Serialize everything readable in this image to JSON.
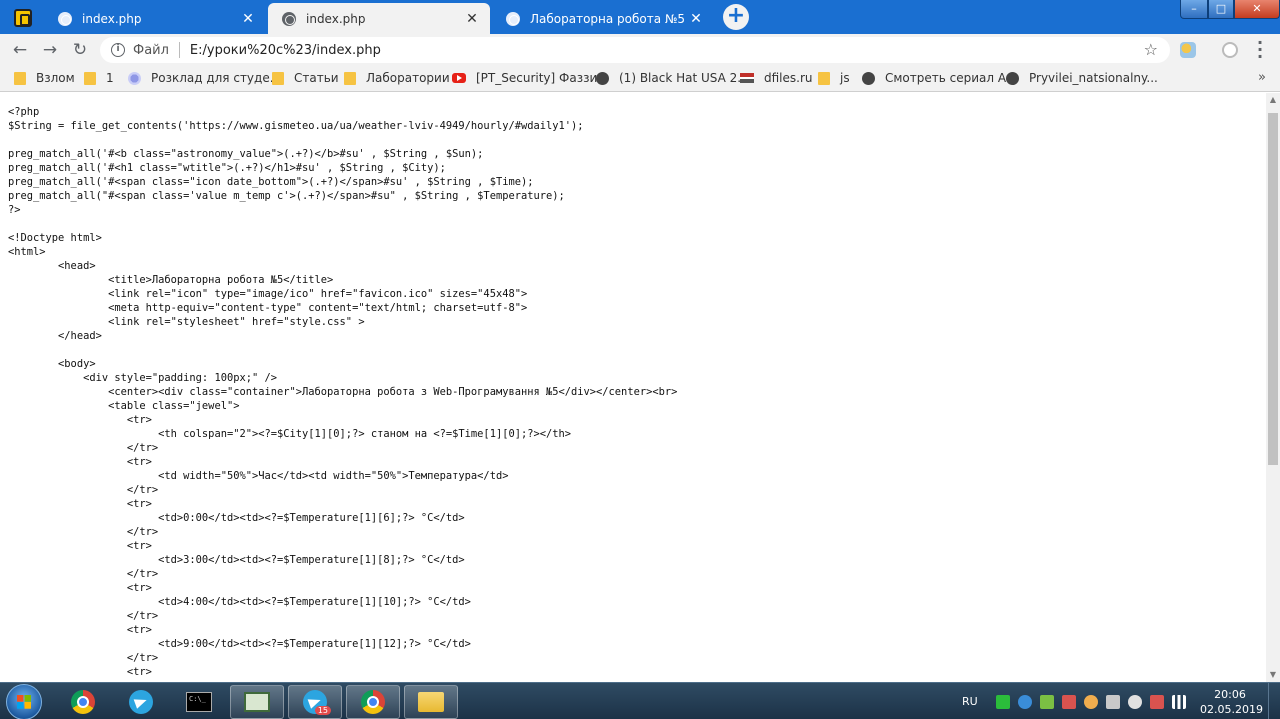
{
  "tabs": [
    {
      "title": "index.php",
      "active": false
    },
    {
      "title": "index.php",
      "active": true
    },
    {
      "title": "Лабораторна робота №5",
      "active": false
    }
  ],
  "window_controls": {
    "minimize": "–",
    "maximize": "□",
    "close": "✕"
  },
  "address_bar": {
    "scheme_label": "Файл",
    "url": "E:/уроки%20c%23/index.php"
  },
  "bookmarks": [
    {
      "label": "Взлом",
      "icon": "folder-icon"
    },
    {
      "label": "1",
      "icon": "folder-icon"
    },
    {
      "label": "Розклад для студе...",
      "icon": "schedule-icon"
    },
    {
      "label": "Статьи",
      "icon": "folder-icon"
    },
    {
      "label": "Лаборатории",
      "icon": "folder-icon"
    },
    {
      "label": "[PT_Security] Фаззи...",
      "icon": "youtube-icon"
    },
    {
      "label": "(1) Black Hat USA 2...",
      "icon": "github-icon"
    },
    {
      "label": "dfiles.ru",
      "icon": "dfiles-icon"
    },
    {
      "label": "js",
      "icon": "folder-icon"
    },
    {
      "label": "Смотреть сериал А...",
      "icon": "github-icon"
    },
    {
      "label": "Pryvilei_natsionalny...",
      "icon": "github-icon"
    }
  ],
  "bookmarks_more": "»",
  "code_lines": [
    "<?php",
    "$String = file_get_contents('https://www.gismeteo.ua/ua/weather-lviv-4949/hourly/#wdaily1');",
    "",
    "preg_match_all('#<b class=\"astronomy_value\">(.+?)</b>#su' , $String , $Sun);",
    "preg_match_all('#<h1 class=\"wtitle\">(.+?)</h1>#su' , $String , $City);",
    "preg_match_all('#<span class=\"icon date_bottom\">(.+?)</span>#su' , $String , $Time);",
    "preg_match_all(\"#<span class='value m_temp c'>(.+?)</span>#su\" , $String , $Temperature);",
    "?>",
    "",
    "<!Doctype html>",
    "<html>",
    "        <head>",
    "                <title>Лабораторна робота №5</title>",
    "                <link rel=\"icon\" type=\"image/ico\" href=\"favicon.ico\" sizes=\"45x48\">",
    "                <meta http-equiv=\"content-type\" content=\"text/html; charset=utf-8\">",
    "                <link rel=\"stylesheet\" href=\"style.css\" >",
    "        </head>",
    "",
    "        <body>",
    "            <div style=\"padding: 100px;\" />",
    "                <center><div class=\"container\">Лабораторна робота з Web-Програмування №5</div></center><br>",
    "                <table class=\"jewel\">",
    "                   <tr>",
    "                        <th colspan=\"2\"><?=$City[1][0];?> станом на <?=$Time[1][0];?></th>",
    "                   </tr>",
    "                   <tr>",
    "                        <td width=\"50%\">Час</td><td width=\"50%\">Температура</td>",
    "                   </tr>",
    "                   <tr>",
    "                        <td>0:00</td><td><?=$Temperature[1][6];?> °C</td>",
    "                   </tr>",
    "                   <tr>",
    "                        <td>3:00</td><td><?=$Temperature[1][8];?> °C</td>",
    "                   </tr>",
    "                   <tr>",
    "                        <td>4:00</td><td><?=$Temperature[1][10];?> °C</td>",
    "                   </tr>",
    "                   <tr>",
    "                        <td>9:00</td><td><?=$Temperature[1][12];?> °C</td>",
    "                   </tr>",
    "                   <tr>"
  ],
  "taskbar": {
    "apps": [
      {
        "name": "chrome",
        "running": false
      },
      {
        "name": "telegram",
        "running": false
      },
      {
        "name": "cmd",
        "running": false,
        "label": "C:\\_"
      },
      {
        "name": "monitor",
        "running": true
      },
      {
        "name": "telegram",
        "running": true,
        "badge": "15"
      },
      {
        "name": "chrome",
        "running": true
      },
      {
        "name": "explorer",
        "running": true
      }
    ],
    "language": "RU",
    "time": "20:06",
    "date": "02.05.2019"
  }
}
